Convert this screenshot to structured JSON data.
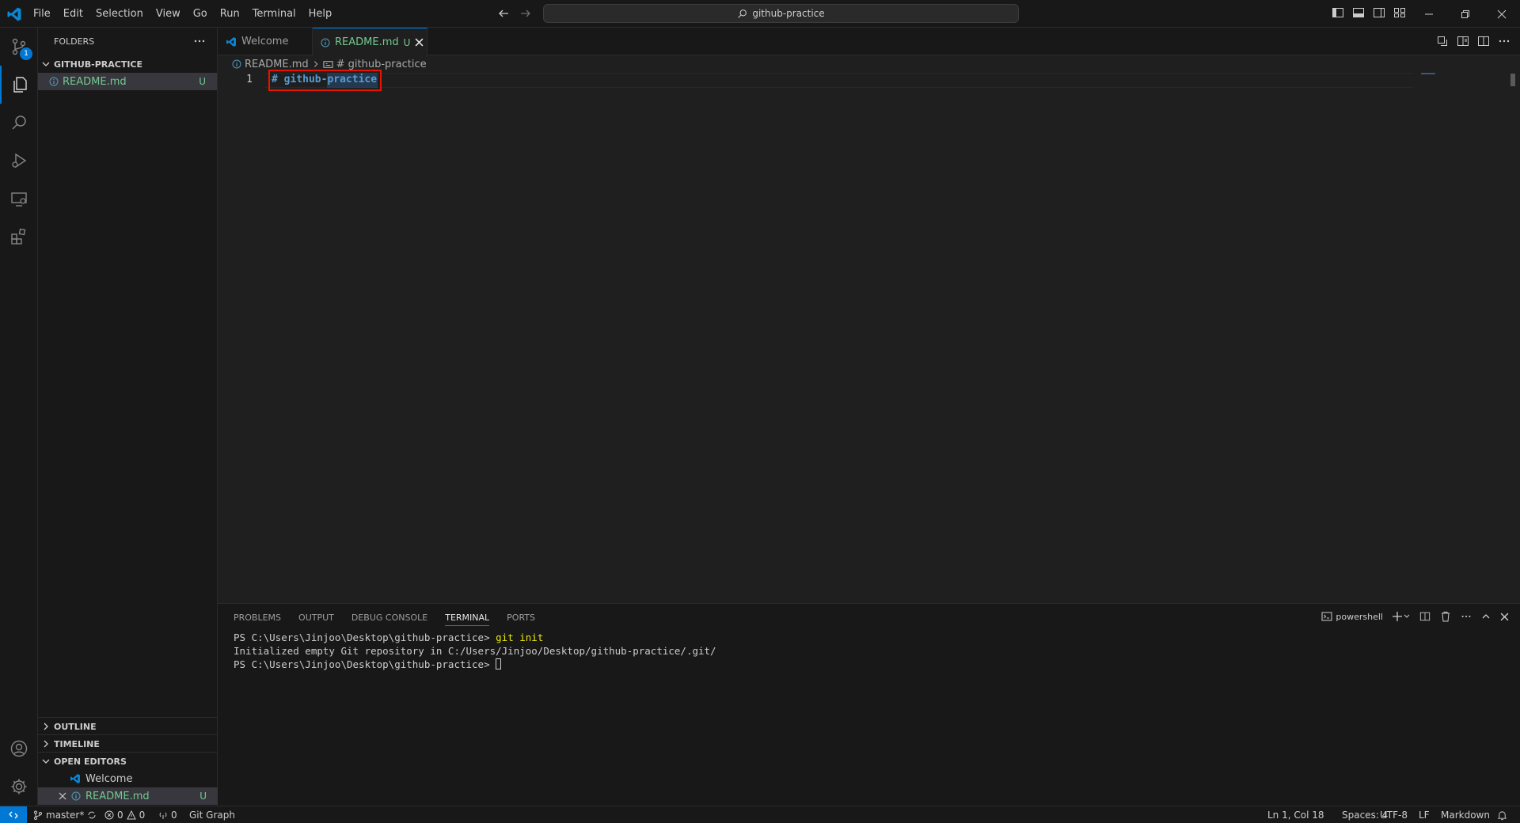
{
  "menu": [
    "File",
    "Edit",
    "Selection",
    "View",
    "Go",
    "Run",
    "Terminal",
    "Help"
  ],
  "command_center": "github-practice",
  "activity": {
    "source_control_badge": "1"
  },
  "sidebar": {
    "title": "FOLDERS",
    "folder": "GITHUB-PRACTICE",
    "files": [
      {
        "name": "README.md",
        "status": "U"
      }
    ],
    "outline": "OUTLINE",
    "timeline": "TIMELINE",
    "open_editors": {
      "title": "OPEN EDITORS",
      "items": [
        {
          "name": "Welcome",
          "status": ""
        },
        {
          "name": "README.md",
          "status": "U"
        }
      ]
    }
  },
  "tabs": [
    {
      "label": "Welcome"
    },
    {
      "label": "README.md",
      "status": "U"
    }
  ],
  "breadcrumb": {
    "file": "README.md",
    "symbol": "# github-practice"
  },
  "editor": {
    "line_number": "1",
    "code": "# github-practice"
  },
  "panel": {
    "tabs": [
      "PROBLEMS",
      "OUTPUT",
      "DEBUG CONSOLE",
      "TERMINAL",
      "PORTS"
    ],
    "active_tab": "TERMINAL",
    "shell": "powershell",
    "terminal": {
      "line1_prompt": "PS C:\\Users\\Jinjoo\\Desktop\\github-practice>",
      "line1_cmd": "git init",
      "line2": "Initialized empty Git repository in C:/Users/Jinjoo/Desktop/github-practice/.git/",
      "line3_prompt": "PS C:\\Users\\Jinjoo\\Desktop\\github-practice>"
    }
  },
  "status": {
    "branch": "master*",
    "errors": "0",
    "warnings": "0",
    "ports": "0",
    "git_graph": "Git Graph",
    "position": "Ln 1, Col 18",
    "spaces": "Spaces: 4",
    "encoding": "UTF-8",
    "eol": "LF",
    "language": "Markdown"
  },
  "colors": {
    "accent": "#0078d4",
    "git_untracked": "#73c991",
    "highlight_box": "#e51400"
  }
}
